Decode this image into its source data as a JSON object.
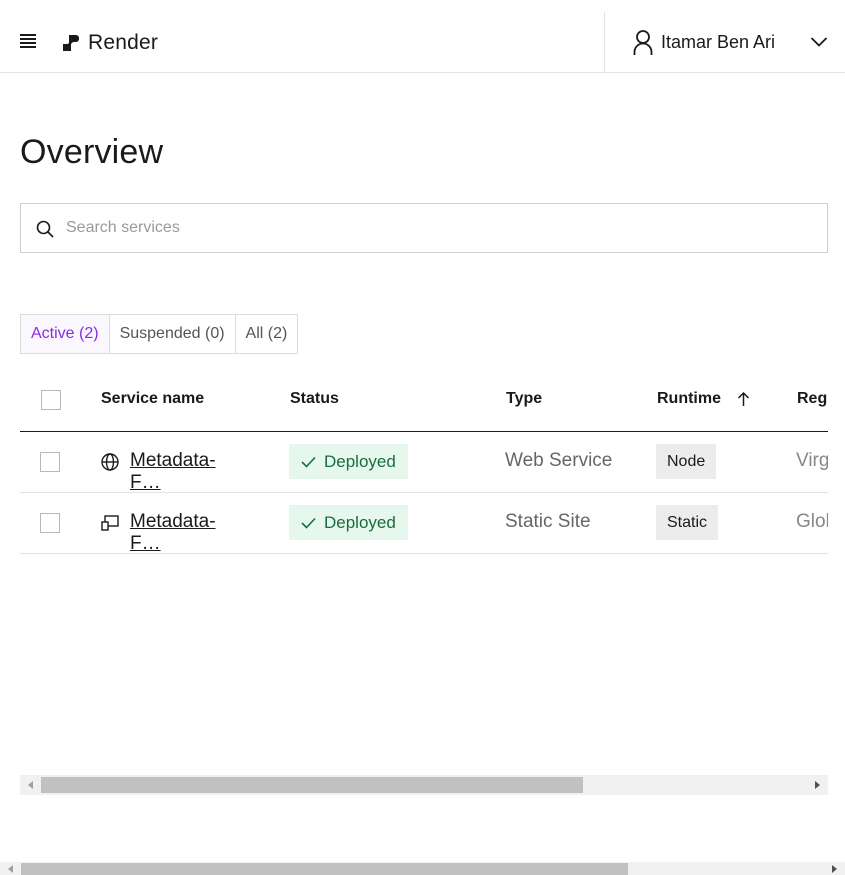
{
  "header": {
    "menu_icon": "hamburger-menu-icon",
    "brand": "Render",
    "user_name": "Itamar Ben Ari",
    "user_icon": "user-icon",
    "dropdown_icon": "chevron-down-icon"
  },
  "page": {
    "title": "Overview"
  },
  "search": {
    "placeholder": "Search services",
    "value": ""
  },
  "tabs": [
    {
      "label": "Active (2)",
      "active": true
    },
    {
      "label": "Suspended (0)",
      "active": false
    },
    {
      "label": "All (2)",
      "active": false
    }
  ],
  "table": {
    "columns": {
      "service_name": "Service name",
      "status": "Status",
      "type": "Type",
      "runtime": "Runtime",
      "region": "Reg"
    },
    "sort_icon": "arrow-up-icon",
    "rows": [
      {
        "icon": "globe-icon",
        "name": "Metadata-F…",
        "status": "Deployed",
        "type": "Web Service",
        "runtime": "Node",
        "region": "Virg"
      },
      {
        "icon": "static-site-icon",
        "name": "Metadata-F…",
        "status": "Deployed",
        "type": "Static Site",
        "runtime": "Static",
        "region": "Glol"
      }
    ]
  },
  "colors": {
    "accent": "#8a2be2",
    "status_bg": "#e6f8ee",
    "status_text": "#1a6b3f",
    "runtime_bg": "#ececec"
  }
}
